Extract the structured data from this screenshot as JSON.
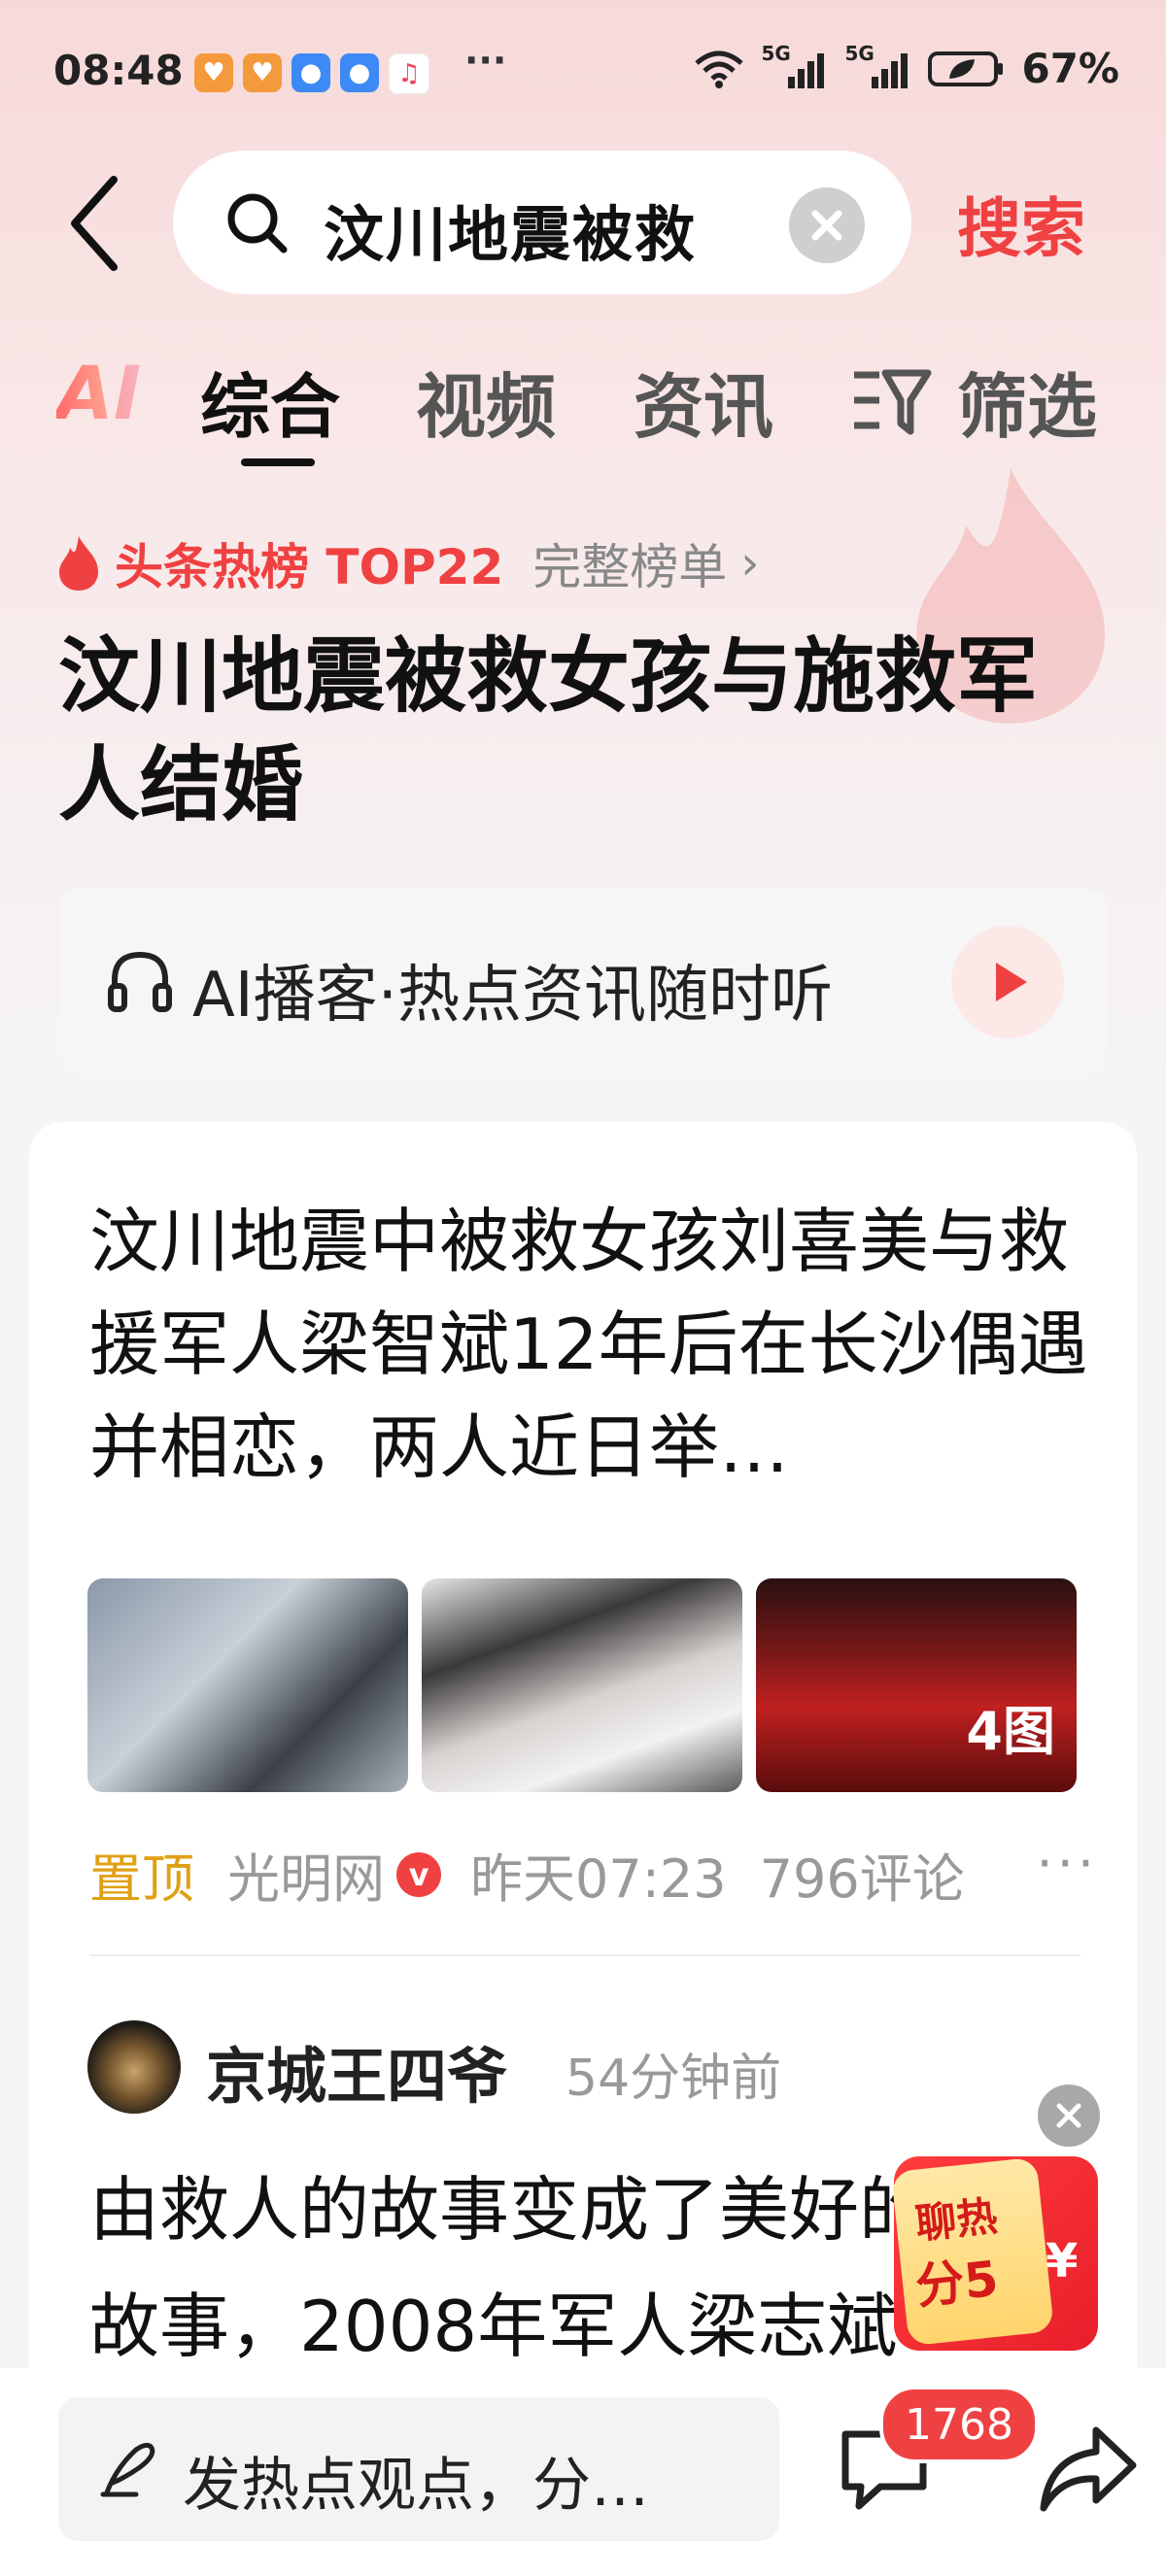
{
  "status_bar": {
    "time": "08:48",
    "signal1": "5G",
    "signal2": "5G",
    "battery": "67%"
  },
  "search": {
    "query": "汶川地震被救",
    "submit_label": "搜索"
  },
  "tabs": [
    {
      "label": "综合",
      "active": true
    },
    {
      "label": "视频",
      "active": false
    },
    {
      "label": "资讯",
      "active": false
    },
    {
      "label": "筛选",
      "active": false
    }
  ],
  "ai_logo": "AI",
  "hot": {
    "label": "头条热榜 TOP22",
    "full_list": "完整榜单",
    "headline": "汶川地震被救女孩与施救军人结婚"
  },
  "podcast": {
    "label": "AI播客·热点资讯随时听"
  },
  "article": {
    "title": "汶川地震中被救女孩刘喜美与救援军人梁智斌12年后在长沙偶遇并相恋，两人近日举…",
    "image_count": "4图",
    "pinned": "置顶",
    "source": "光明网",
    "verified_mark": "v",
    "time": "昨天07:23",
    "comments": "796评论",
    "more": "···"
  },
  "comment": {
    "author": "京城王四爷",
    "time": "54分钟前",
    "text": "由救人的故事变成了美好的爱情故事，2008年军人梁志斌"
  },
  "red_envelope": {
    "line1": "聊热",
    "line2": "分5",
    "yen": "¥"
  },
  "bottom": {
    "input_placeholder": "发热点观点，分…",
    "message_count": "1768"
  },
  "colors": {
    "accent": "#f04142",
    "pin": "#e0a015"
  }
}
